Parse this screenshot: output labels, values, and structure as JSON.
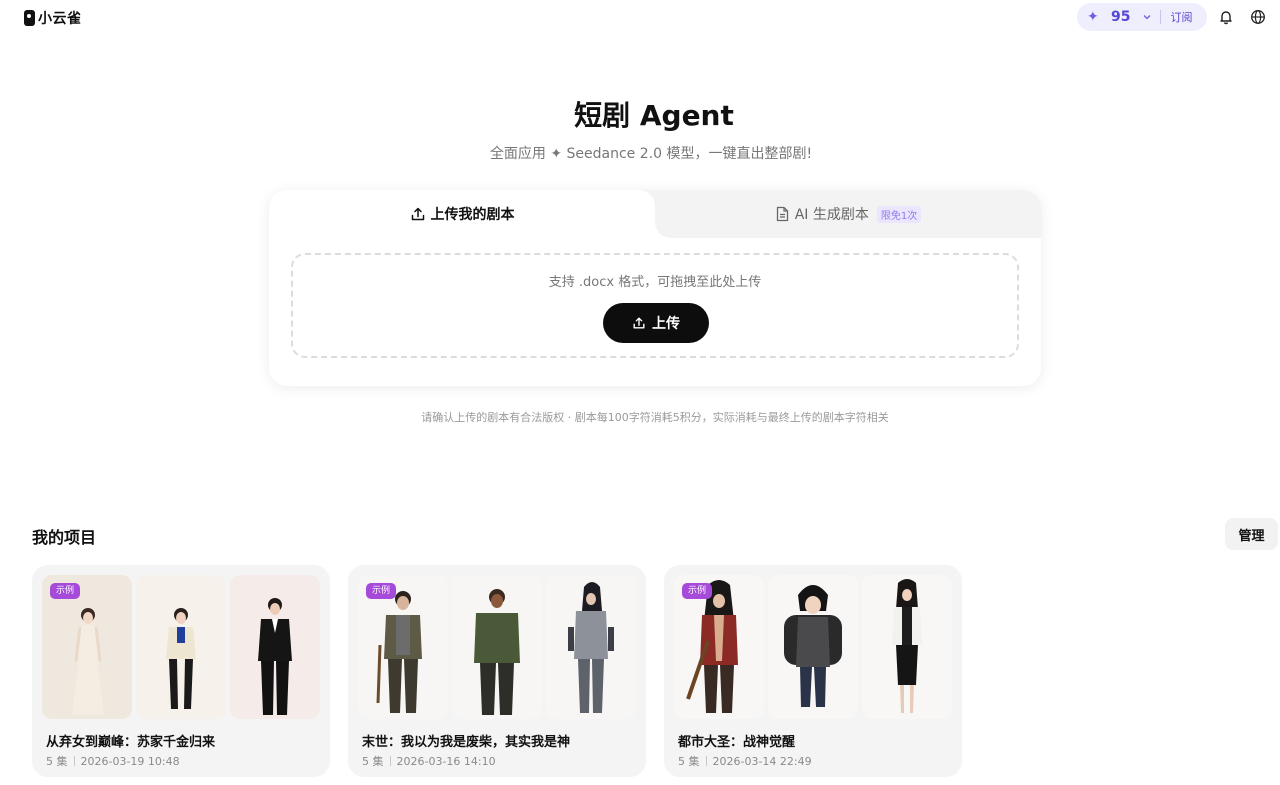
{
  "app": {
    "name": "小云雀"
  },
  "header": {
    "credits": "95",
    "subscribe_label": "订阅"
  },
  "hero": {
    "title": "短剧 Agent",
    "subtitle": "全面应用 ✦ Seedance 2.0 模型，一键直出整部剧!"
  },
  "upload_card": {
    "tabs": [
      {
        "label": "上传我的剧本",
        "active": true
      },
      {
        "label": "AI 生成剧本",
        "badge": "限免1次",
        "active": false
      }
    ],
    "dropzone_hint": "支持 .docx 格式，可拖拽至此处上传",
    "upload_button": "上传"
  },
  "notice": "请确认上传的剧本有合法版权 · 剧本每100字符消耗5积分，实际消耗与最终上传的剧本字符相关",
  "projects": {
    "section_title": "我的项目",
    "manage_label": "管理",
    "items": [
      {
        "badge": "示例",
        "title": "从弃女到巅峰：苏家千金归来",
        "episodes": "5 集",
        "date": "2026-03-19 10:48"
      },
      {
        "badge": "示例",
        "title": "末世：我以为我是废柴，其实我是神",
        "episodes": "5 集",
        "date": "2026-03-16 14:10"
      },
      {
        "badge": "示例",
        "title": "都市大圣：战神觉醒",
        "episodes": "5 集",
        "date": "2026-03-14 22:49"
      }
    ]
  },
  "colors": {
    "accent": "#5546d6",
    "badge": "#a64ad9",
    "primary_button": "#0d0d0d"
  },
  "icons": [
    "logo-icon",
    "sparkle-icon",
    "chevron-down-icon",
    "bell-icon",
    "globe-icon",
    "upload-icon",
    "document-icon"
  ]
}
